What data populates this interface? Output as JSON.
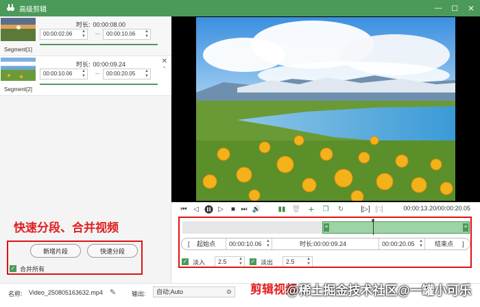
{
  "window": {
    "title": "高级剪辑"
  },
  "segments": [
    {
      "label": "Segment[1]",
      "duration_label": "时长:",
      "duration": "00:00:08.00",
      "start": "00:00:02.06",
      "end": "00:00:10.06"
    },
    {
      "label": "Segment[2]",
      "duration_label": "时长:",
      "duration": "00:00:09.24",
      "start": "00:00:10.06",
      "end": "00:00:20.05"
    }
  ],
  "left_actions": {
    "add_segment": "新增片段",
    "quick_split": "快速分段",
    "merge_all": "合并所有"
  },
  "annotation_left": "快速分段、合并视频",
  "annotation_bottom": "剪辑视频",
  "player": {
    "timecode": "00:00:13.20/00:00:20.05"
  },
  "trim": {
    "start_label": "起始点",
    "start": "00:00:10.06",
    "duration_label": "时长:",
    "duration": "00:00:09.24",
    "end": "00:00:20.05",
    "end_label": "结束点",
    "fade_in_label": "淡入",
    "fade_in": "2.5",
    "fade_out_label": "淡出",
    "fade_out": "2.5"
  },
  "bottom": {
    "name_label": "名称:",
    "name_value": "Video_250805163632.mp4",
    "output_label": "输出:",
    "output_value": "自动;Auto"
  },
  "watermark": {
    "line1": "@稀土掘金技术社区",
    "line2": "@一罐小可乐"
  },
  "colors": {
    "accent": "#4b9a5a",
    "annotation": "#e01010"
  }
}
